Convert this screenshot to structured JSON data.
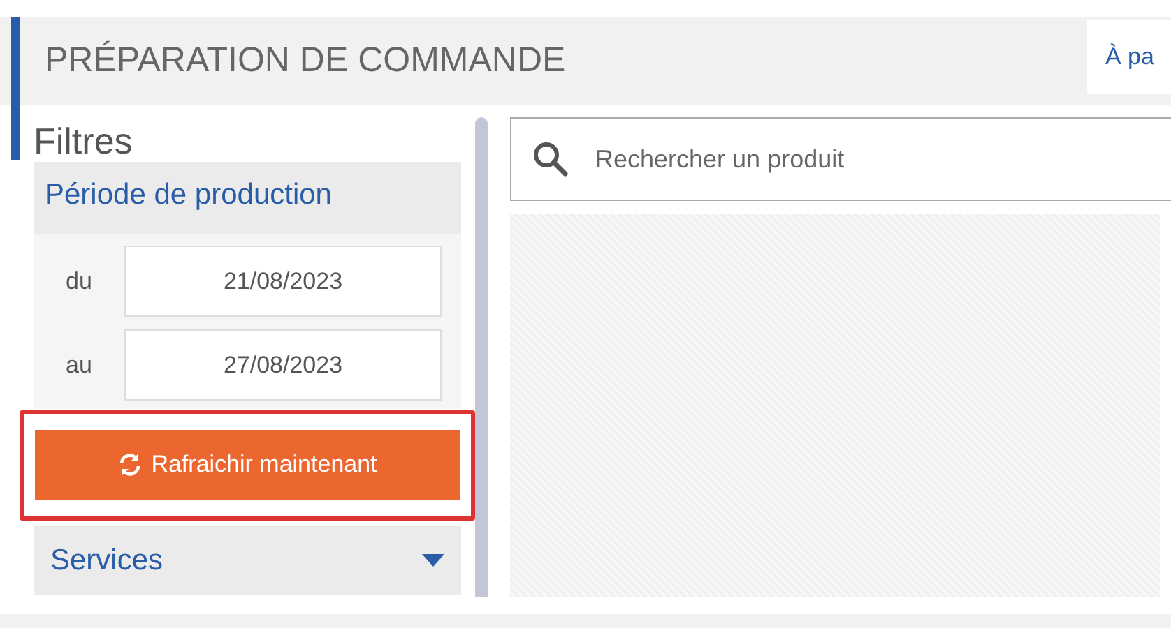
{
  "header": {
    "title": "PRÉPARATION DE COMMANDE",
    "link": "À pa"
  },
  "filters": {
    "title": "Filtres",
    "period": {
      "title": "Période de production",
      "dates": [
        {
          "label": "du",
          "value": "21/08/2023"
        },
        {
          "label": "au",
          "value": "27/08/2023"
        }
      ]
    },
    "refresh_button": {
      "label": "Rafraichir maintenant",
      "highlighted": true
    },
    "sections": [
      {
        "label": "Services",
        "expanded": false
      }
    ]
  },
  "search": {
    "placeholder": "Rechercher un produit"
  }
}
